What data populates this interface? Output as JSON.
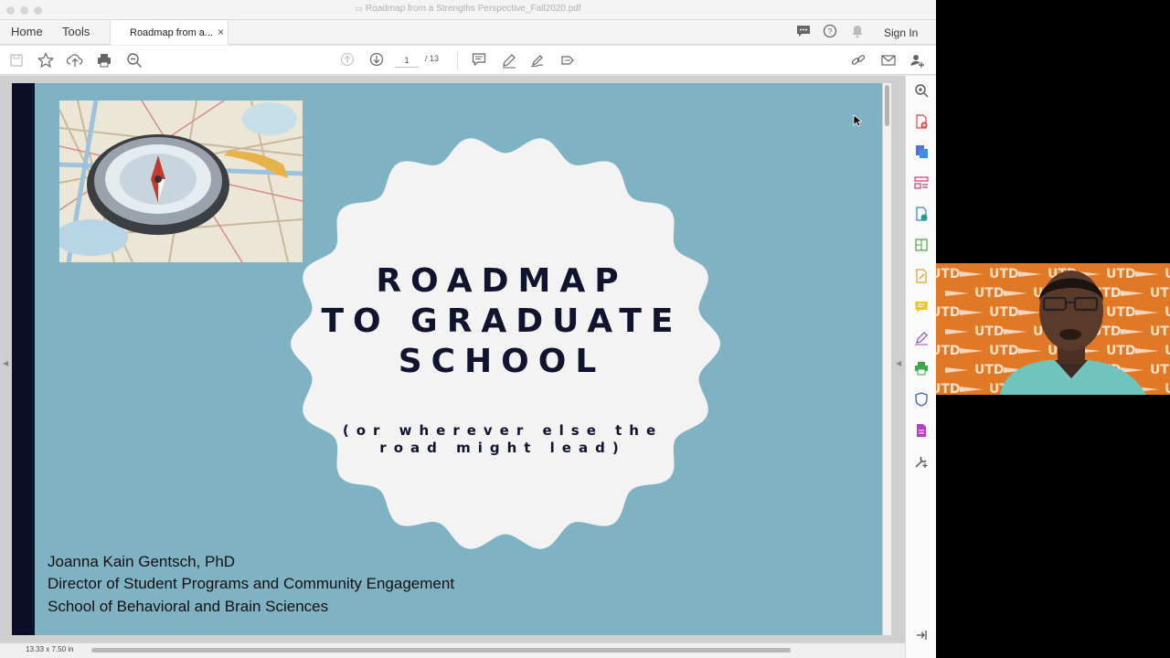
{
  "window": {
    "title": "Roadmap from a Strengths Perspective_Fall2020.pdf"
  },
  "nav": {
    "home": "Home",
    "tools": "Tools",
    "tab_label": "Roadmap from a...",
    "tab_close": "×",
    "sign_in": "Sign In"
  },
  "toolbar": {
    "page_current": "1",
    "page_total": "/ 13"
  },
  "slide": {
    "title": "ROADMAP\nTO GRADUATE\nSCHOOL",
    "subtitle": "(or wherever else the road might lead)",
    "author_name": "Joanna Kain Gentsch, PhD",
    "author_title": "Director of Student Programs and Community Engagement",
    "author_school": "School of Behavioral and Brain Sciences"
  },
  "status": {
    "page_size": "13.33 x 7.50 in"
  },
  "icons": {
    "toolbar_left": [
      "save-icon",
      "bookmark-star-icon",
      "upload-icon",
      "print-icon",
      "zoom-out-icon"
    ],
    "toolbar_center": [
      "prev-page-icon",
      "next-page-icon",
      "comment-icon",
      "pen-icon",
      "sign-icon",
      "share-icon"
    ],
    "toolbar_right": [
      "link-icon",
      "email-icon",
      "add-user-icon"
    ],
    "top_right": [
      "chat-icon",
      "help-icon",
      "bell-icon"
    ],
    "right_panel": [
      "search-zoom-icon",
      "create-pdf-icon",
      "export-pdf-icon",
      "organize-pages-icon",
      "edit-pdf-icon",
      "combine-files-icon",
      "fill-sign-icon",
      "comment-tool-icon",
      "fill-sign-pen-icon",
      "print-production-icon",
      "protect-icon",
      "more-tools-icon",
      "custom-tool-icon",
      "expand-panel-icon"
    ]
  },
  "colors": {
    "slide_bg": "#7fb3c3",
    "slide_band": "#0d0f2a",
    "scallop": "#f3f3f3",
    "title_text": "#10142e",
    "webcam_bg": "#e07826"
  },
  "webcam": {
    "logo_text": "UTD"
  }
}
